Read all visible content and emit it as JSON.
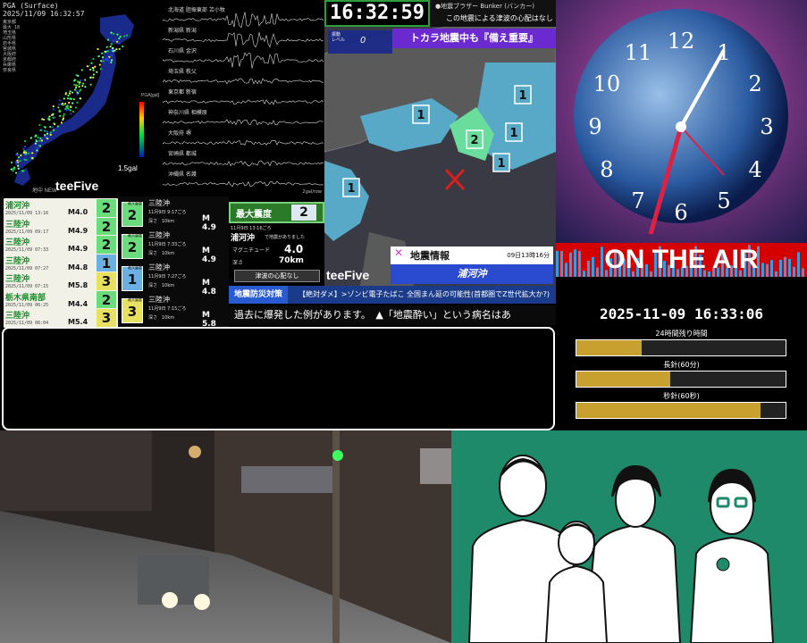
{
  "pga": {
    "title": "PGA (Surface)",
    "timestamp": "2025/11/09 16:32:57",
    "stations": [
      "東京都",
      "最大 18",
      "埼玉県",
      "山形県",
      "岩手県",
      "宮城県",
      "大阪府",
      "京都府",
      "兵庫県",
      "奈良県"
    ],
    "scale_label": "1.5gal",
    "unit": "PGA[gal]",
    "scale_ticks": [
      "1000",
      "500",
      "200",
      "100",
      "50",
      "20",
      "10",
      "5",
      "2",
      "1",
      "0.5",
      "0.2",
      "0.1"
    ],
    "footer": "地中 NEW",
    "logo": "teeFive"
  },
  "seismograph": {
    "stations": [
      "北海道 胆振東部 苫小牧",
      "新潟県 新潟",
      "石川県 金沢",
      "埼玉県 秩父",
      "東京都 新宿",
      "神奈川県 相模原",
      "大阪府 堺",
      "宮崎県 都城",
      "沖縄県 名護"
    ],
    "footer": "2gal/row"
  },
  "eew_list": [
    {
      "name": "浦河沖",
      "date": "2025/11/09 13:16",
      "mag": "M4.0",
      "intensity": "2"
    },
    {
      "name": "三陸沖",
      "date": "2025/11/09 09:17",
      "mag": "M4.9",
      "intensity": "2"
    },
    {
      "name": "三陸沖",
      "date": "2025/11/09 07:33",
      "mag": "M4.9",
      "intensity": "2"
    },
    {
      "name": "三陸沖",
      "date": "2025/11/09 07:27",
      "mag": "M4.8",
      "intensity": "1"
    },
    {
      "name": "三陸沖",
      "date": "2025/11/09 07:15",
      "mag": "M5.8",
      "intensity": "3"
    },
    {
      "name": "栃木県南部",
      "date": "2025/11/09 06:25",
      "mag": "M4.4",
      "intensity": "2"
    },
    {
      "name": "三陸沖",
      "date": "2025/11/09 06:04",
      "mag": "M5.4",
      "intensity": "3"
    }
  ],
  "eew_detail_rows": [
    {
      "label": "最大震度",
      "intensity": "2",
      "name": "三陸沖",
      "time": "11月9日 9:17ごろ",
      "depth": "深さ　10km",
      "mag": "M 4.9"
    },
    {
      "label": "最大震度",
      "intensity": "2",
      "name": "三陸沖",
      "time": "11月9日 7:33ごろ",
      "depth": "深さ　10km",
      "mag": "M 4.9"
    },
    {
      "label": "最大震度",
      "intensity": "1",
      "name": "三陸沖",
      "time": "11月9日 7:27ごろ",
      "depth": "深さ　10km",
      "mag": "M 4.8"
    },
    {
      "label": "最大震度",
      "intensity": "3",
      "name": "三陸沖",
      "time": "11月9日 7:15ごろ",
      "depth": "深さ　10km",
      "mag": "M 5.8"
    }
  ],
  "latest": {
    "max_label": "最大震度",
    "max_intensity": "2",
    "time": "11月9日 13:16ごろ",
    "region": "浦河沖",
    "region_note": "で地震がありました",
    "mag_label": "マグニチュード",
    "mag": "4.0",
    "depth_label": "深さ",
    "depth": "70km",
    "tsunami": "津波の心配なし"
  },
  "top_clock": "16:32:59",
  "top_news": {
    "line1": "●地震ブラザー Bunker (バンカー)",
    "line2": "この地震による津波の心配はなし"
  },
  "map": {
    "level_label": "振動\nレベル",
    "level_value": "0",
    "banner": "トカラ地震中も『備え重要』",
    "info_title": "地震情報",
    "info_time": "09日13時16分",
    "info_region": "浦河沖",
    "logo": "teeFive",
    "intensity_marks": [
      "1",
      "1",
      "2",
      "1",
      "1",
      "1"
    ]
  },
  "strip1": {
    "tag": "地震防災対策",
    "text": "【絶対ダメ】>ゾンビ電子たばこ 全国まん延の可能性(首都圏でZ世代拡大か?)"
  },
  "strip2": {
    "text": "過去に爆発した例があります。　▲「地震酔い」という病名はあ"
  },
  "clock": {
    "numbers": [
      "12",
      "1",
      "2",
      "3",
      "4",
      "5",
      "6",
      "7",
      "8",
      "9",
      "10",
      "11"
    ],
    "onair": "ON THE AIR",
    "datetime": "2025-11-09 16:33:06",
    "bars": [
      {
        "label": "24時間残り時間",
        "fill": 0.31
      },
      {
        "label": "長針(60分)",
        "fill": 0.45
      },
      {
        "label": "秒針(60秒)",
        "fill": 0.88
      }
    ]
  },
  "colors": {
    "accent_green": "#2d9d3a",
    "map_sea": "#3a3a44",
    "map_land": "#5a5a5a",
    "shindo1": "#58a8c8",
    "shindo2": "#6adc9c",
    "family_bg": "#1e8a6a",
    "onair_red": "#d40000"
  }
}
